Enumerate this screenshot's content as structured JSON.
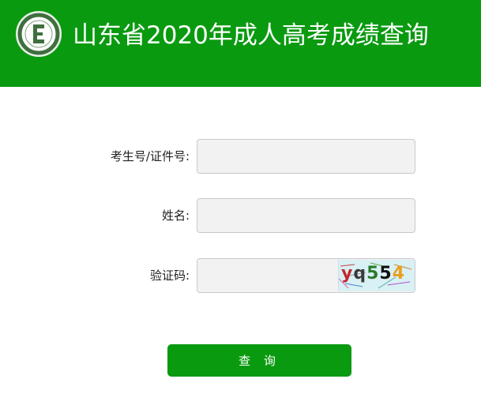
{
  "header": {
    "title": "山东省2020年成人高考成绩查询",
    "logo_letter": "E",
    "background_color": "#0a9a10"
  },
  "form": {
    "fields": [
      {
        "label": "考生号/证件号:",
        "value": "",
        "placeholder": ""
      },
      {
        "label": "姓名:",
        "value": "",
        "placeholder": ""
      },
      {
        "label": "验证码:",
        "value": "",
        "placeholder": ""
      }
    ],
    "captcha": {
      "text": "yq554"
    },
    "submit_label": "查 询"
  },
  "colors": {
    "accent": "#0a9a10",
    "input_background": "#f2f2f2",
    "input_border": "#c9c9c9",
    "captcha_background": "#d9f0f4"
  }
}
